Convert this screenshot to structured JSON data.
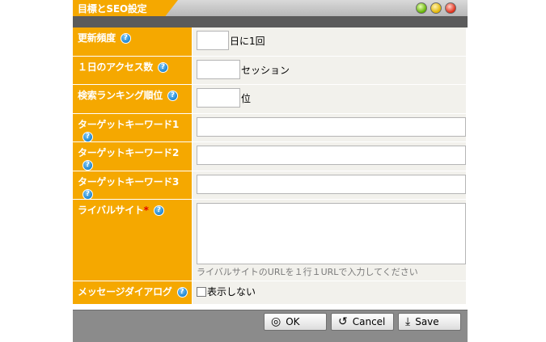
{
  "window": {
    "title": "目標とSEO設定"
  },
  "form": {
    "update_frequency": {
      "label": "更新頻度",
      "value": "",
      "unit": "日に1回"
    },
    "daily_access": {
      "label": "１日のアクセス数",
      "value": "",
      "unit": "セッション"
    },
    "search_ranking": {
      "label": "検索ランキング順位",
      "value": "",
      "unit": "位"
    },
    "target_keyword_1": {
      "label": "ターゲットキーワード1",
      "value": ""
    },
    "target_keyword_2": {
      "label": "ターゲットキーワード2",
      "value": ""
    },
    "target_keyword_3": {
      "label": "ターゲットキーワード3",
      "value": ""
    },
    "rival_sites": {
      "label": "ライバルサイト",
      "required_mark": "*",
      "value": "",
      "hint": "ライバルサイトのURLを１行１URLで入力してください"
    },
    "message_dialog": {
      "label": "メッセージダイアログ",
      "checkbox_label": "表示しない",
      "checked": false
    }
  },
  "help_icon_glyph": "?",
  "buttons": {
    "ok": "OK",
    "cancel": "Cancel",
    "save": "Save"
  },
  "icons": {
    "help": "help-icon",
    "ok": "ok-icon",
    "cancel": "cancel-icon",
    "save": "save-icon"
  },
  "colors": {
    "accent": "#f5a800",
    "title_bar": "#c8c8c8",
    "band": "#5b5b5b",
    "footer": "#8b8b8b",
    "value_bg": "#f2f1ec",
    "help": "#1f86d0",
    "required": "#e00000"
  }
}
